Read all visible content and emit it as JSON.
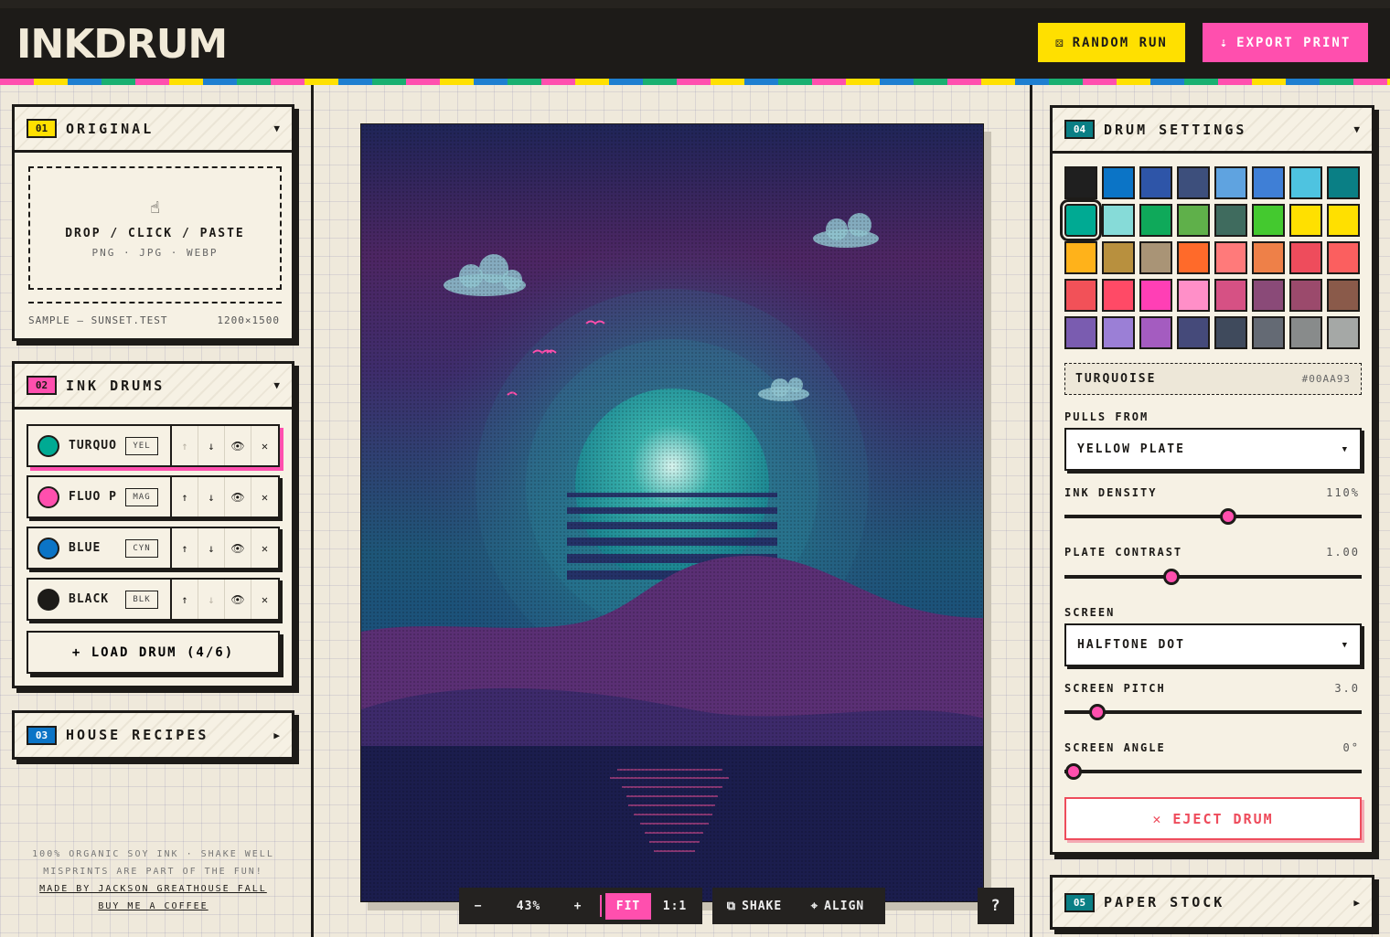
{
  "app": {
    "logo": "INKDRUM"
  },
  "header": {
    "random_label": "RANDOM RUN",
    "random_icon": "⚄",
    "export_label": "EXPORT PRINT",
    "export_icon": "⇣"
  },
  "original": {
    "num": "01",
    "title": "ORIGINAL",
    "drop_label": "DROP / CLICK / PASTE",
    "formats": "PNG · JPG · WEBP",
    "sample_name": "SAMPLE — SUNSET.TEST",
    "sample_size": "1200×1500"
  },
  "ink_drums": {
    "num": "02",
    "title": "INK DRUMS",
    "drums": [
      {
        "name": "TURQUO",
        "plate": "YEL",
        "color": "#00aa93"
      },
      {
        "name": "FLUO P",
        "plate": "MAG",
        "color": "#ff4fae"
      },
      {
        "name": "BLUE",
        "plate": "CYN",
        "color": "#0b74c6"
      },
      {
        "name": "BLACK",
        "plate": "BLK",
        "color": "#1d1b18"
      }
    ],
    "load_label": "+ LOAD DRUM (4/6)"
  },
  "recipes": {
    "num": "03",
    "title": "HOUSE RECIPES"
  },
  "footer": {
    "line1": "100% ORGANIC SOY INK · SHAKE WELL",
    "line2": "MISPRINTS ARE PART OF THE FUN!",
    "line3": "MADE BY JACKSON GREATHOUSE FALL",
    "line4": "BUY ME A COFFEE"
  },
  "zoom": {
    "minus": "−",
    "value": "43%",
    "plus": "+",
    "fit": "FIT",
    "one_to_one": "1:1",
    "shake": "SHAKE",
    "align": "ALIGN",
    "help": "?"
  },
  "drum_settings": {
    "num": "04",
    "title": "DRUM SETTINGS",
    "palette": [
      "#1f1f1f",
      "#0b74c6",
      "#2e55a8",
      "#3d4f7c",
      "#5fa3e0",
      "#3f7fd6",
      "#4ec3e0",
      "#0a7f85",
      "#00aa93",
      "#86dbd8",
      "#0fa95a",
      "#5fb04a",
      "#3f6b5e",
      "#44c92f",
      "#ffe000",
      "#ffe000",
      "#ffb21a",
      "#b8903e",
      "#a99476",
      "#ff6a2a",
      "#ff7a7a",
      "#ee8048",
      "#ee4c5c",
      "#fb5f5f",
      "#f25158",
      "#ff4a66",
      "#ff3fb5",
      "#ff8fc8",
      "#d65184",
      "#8a4a78",
      "#9b4a6c",
      "#8a5a4a",
      "#7a5cb0",
      "#9b7fd6",
      "#a45cc0",
      "#454a7a",
      "#3f4a5c",
      "#646a74",
      "#888b8b",
      "#a5a8a6"
    ],
    "selected_color_name": "TURQUOISE",
    "selected_color_hex": "#00AA93",
    "pulls_from_label": "PULLS FROM",
    "pulls_from_value": "YELLOW PLATE",
    "density_label": "INK DENSITY",
    "density_value": "110%",
    "density_level": 0.55,
    "contrast_label": "PLATE CONTRAST",
    "contrast_value": "1.00",
    "contrast_level": 0.36,
    "screen_label": "SCREEN",
    "screen_value": "HALFTONE DOT",
    "pitch_label": "SCREEN PITCH",
    "pitch_value": "3.0",
    "pitch_level": 0.11,
    "angle_label": "SCREEN ANGLE",
    "angle_value": "0°",
    "angle_level": 0.03,
    "eject_label": "✕ EJECT DRUM"
  },
  "paper_stock": {
    "num": "05",
    "title": "PAPER STOCK"
  }
}
